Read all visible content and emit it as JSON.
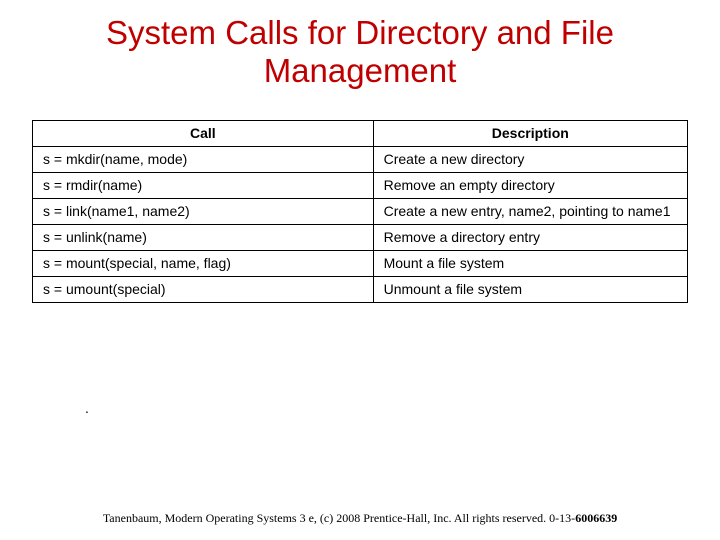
{
  "title": "System Calls for Directory and File Management",
  "table": {
    "headers": {
      "call": "Call",
      "desc": "Description"
    },
    "rows": [
      {
        "call": "s = mkdir(name, mode)",
        "desc": "Create a new directory"
      },
      {
        "call": "s = rmdir(name)",
        "desc": "Remove an empty directory"
      },
      {
        "call": "s = link(name1, name2)",
        "desc": "Create a new entry, name2, pointing to name1"
      },
      {
        "call": "s = unlink(name)",
        "desc": "Remove a directory entry"
      },
      {
        "call": "s = mount(special, name, flag)",
        "desc": "Mount a file system"
      },
      {
        "call": "s = umount(special)",
        "desc": "Unmount a file system"
      }
    ]
  },
  "dot": ".",
  "footer": {
    "text": "Tanenbaum, Modern Operating Systems 3 e, (c) 2008 Prentice-Hall, Inc. All rights reserved. 0-13-",
    "isbn": "6006639"
  }
}
